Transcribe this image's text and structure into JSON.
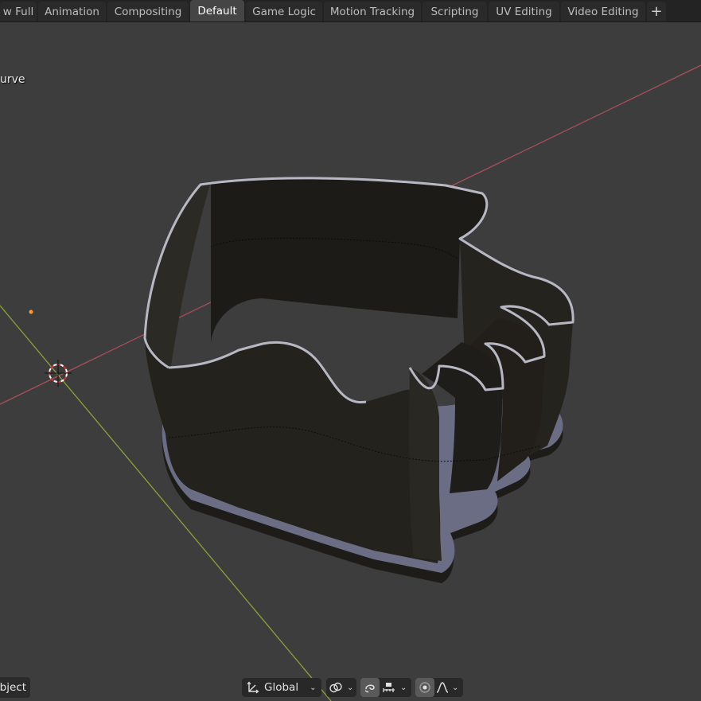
{
  "tabs": [
    {
      "label": "w Full",
      "active": false
    },
    {
      "label": "Animation",
      "active": false
    },
    {
      "label": "Compositing",
      "active": false
    },
    {
      "label": "Default",
      "active": true
    },
    {
      "label": "Game Logic",
      "active": false
    },
    {
      "label": "Motion Tracking",
      "active": false
    },
    {
      "label": "Scripting",
      "active": false
    },
    {
      "label": "UV Editing",
      "active": false
    },
    {
      "label": "Video Editing",
      "active": false
    }
  ],
  "add_tab_label": "+",
  "viewport": {
    "object_name": "urve",
    "mode_label": "bject"
  },
  "header_tools": {
    "transform_orientation": "Global",
    "chevron": "⌄"
  },
  "colors": {
    "background": "#3d3d3d",
    "x_axis": "#a8505a",
    "y_axis": "#8aa33a",
    "object_fill": "#25231e",
    "object_rim": "#b8b8c4",
    "base_plate": "#6b6d85"
  },
  "icons": [
    "transform-orientation-icon",
    "snap-link-icon",
    "snap-magnet-icon",
    "snap-increment-icon",
    "proportional-edit-icon",
    "falloff-curve-icon"
  ]
}
